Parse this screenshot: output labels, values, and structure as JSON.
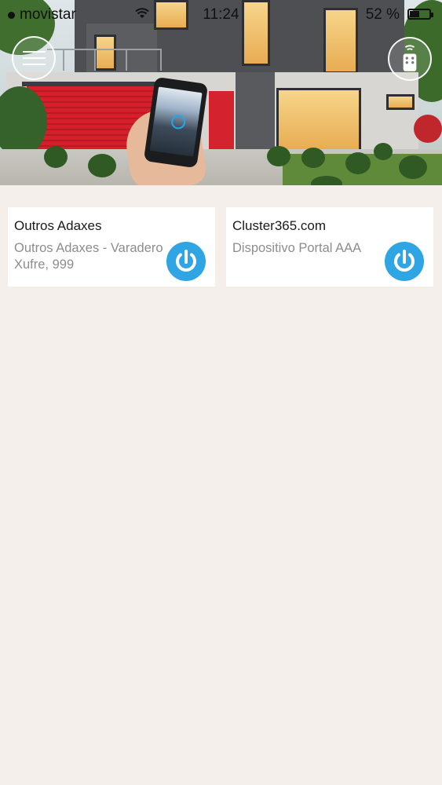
{
  "status_bar": {
    "carrier": "movistar",
    "time": "11:24",
    "battery_percent": "52 %",
    "battery_level": 0.52
  },
  "header": {
    "menu_icon": "hamburger-menu-icon",
    "remote_icon": "remote-control-icon"
  },
  "devices": [
    {
      "title": "Outros Adaxes",
      "subtitle": "Outros Adaxes - Varadero Xufre, 999",
      "icon": "power-icon"
    },
    {
      "title": "Cluster365.com",
      "subtitle": "Dispositivo Portal AAA",
      "icon": "power-icon"
    }
  ],
  "colors": {
    "accent": "#2fa5e4",
    "background": "#f4efeb",
    "card": "#ffffff",
    "title_text": "#1a1a1a",
    "subtitle_text": "#8d8d8d"
  }
}
